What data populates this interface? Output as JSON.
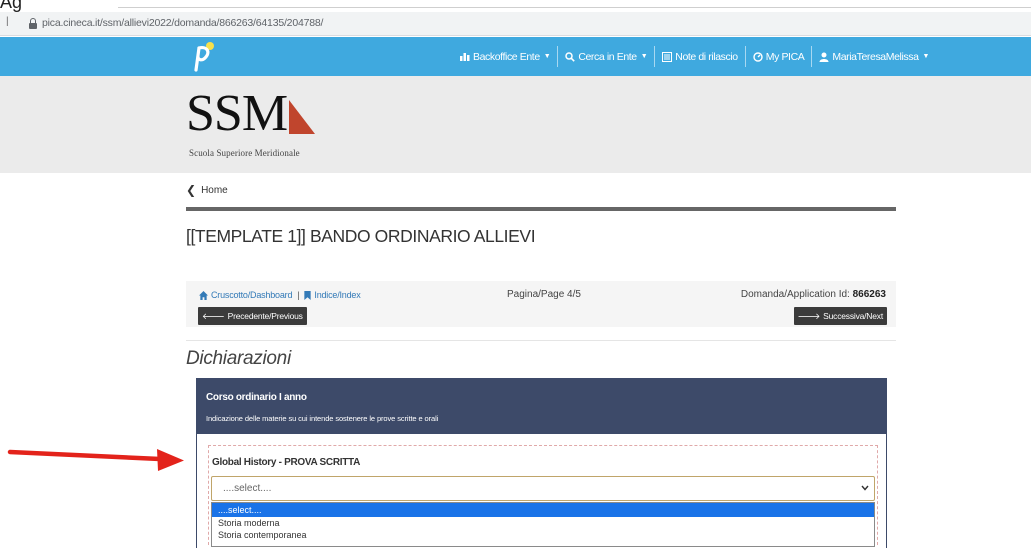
{
  "browser": {
    "top_fragment": "Ag",
    "url": "pica.cineca.it/ssm/allievi2022/domanda/866263/64135/204788/"
  },
  "navbar": {
    "items": [
      {
        "label": "Backoffice Ente",
        "icon": "bar-chart-icon",
        "dropdown": true
      },
      {
        "label": "Cerca in Ente",
        "icon": "search-icon",
        "dropdown": true
      },
      {
        "label": "Note di rilascio",
        "icon": "list-icon",
        "dropdown": false
      },
      {
        "label": "My PICA",
        "icon": "dashboard-icon",
        "dropdown": false
      },
      {
        "label": "MariaTeresaMelissa",
        "icon": "user-icon",
        "dropdown": true
      }
    ],
    "background": "#3fa9df"
  },
  "banner": {
    "logo_text": "SSM",
    "subtitle": "Scuola Superiore Meridionale",
    "accent": "#c0452d"
  },
  "breadcrumb": {
    "home_label": "Home"
  },
  "page": {
    "title": "[[TEMPLATE 1]] BANDO ORDINARIO ALLIEVI"
  },
  "pager": {
    "dashboard_label": "Cruscotto/Dashboard",
    "index_label": "Indice/Index",
    "page_label": "Pagina/Page 4/5",
    "app_id_label": "Domanda/Application Id:",
    "app_id": "866263",
    "prev_label": "Precedente/Previous",
    "next_label": "Successiva/Next"
  },
  "section": {
    "heading": "Dichiarazioni"
  },
  "panel": {
    "title": "Corso ordinario I anno",
    "description": "Indicazione delle materie su cui intende sostenere le prove scritte e orali",
    "header_color": "#3d4a69"
  },
  "field": {
    "label": "Global History - PROVA SCRITTA",
    "selected_value": "....select....",
    "options": [
      "....select....",
      "Storia moderna",
      "Storia contemporanea"
    ],
    "highlight_color": "#1a73e8"
  },
  "annotation": {
    "arrow_color": "#e3231b"
  }
}
